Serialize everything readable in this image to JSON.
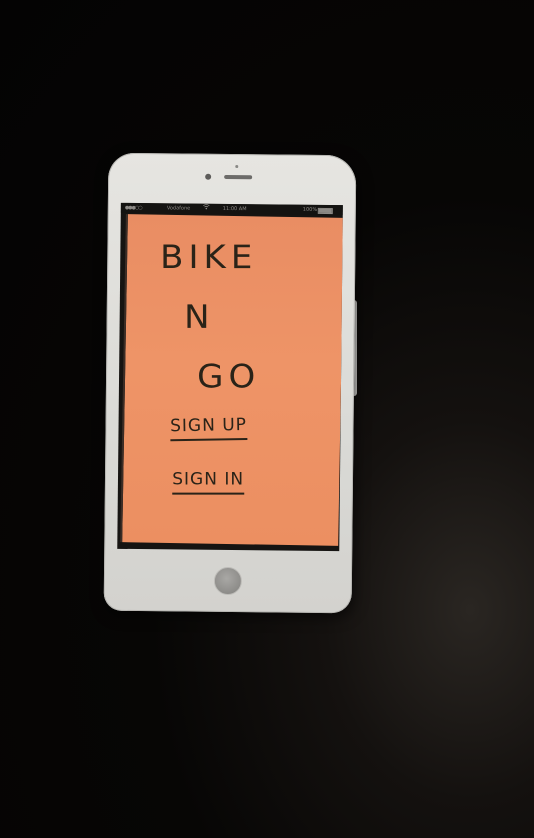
{
  "status_bar": {
    "signal": "●●●○○",
    "carrier": "Vodafone",
    "wifi_icon": "wifi-icon",
    "time": "11:00 AM",
    "battery": "100%"
  },
  "app": {
    "title_line_1": "BIKE",
    "title_line_2": "N",
    "title_line_3": "GO",
    "sign_up_label": "SIGN UP",
    "sign_in_label": "SIGN IN"
  },
  "colors": {
    "paper": "#ee9467",
    "ink": "#2a2318",
    "phone_body": "#dadad6"
  }
}
